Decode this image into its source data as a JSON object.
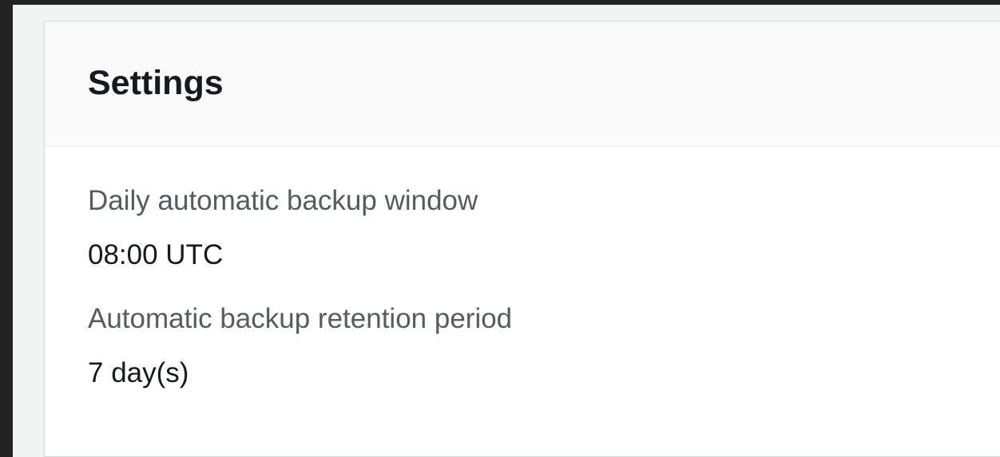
{
  "settings": {
    "title": "Settings",
    "fields": [
      {
        "label": "Daily automatic backup window",
        "value": "08:00 UTC"
      },
      {
        "label": "Automatic backup retention period",
        "value": "7 day(s)"
      }
    ]
  }
}
